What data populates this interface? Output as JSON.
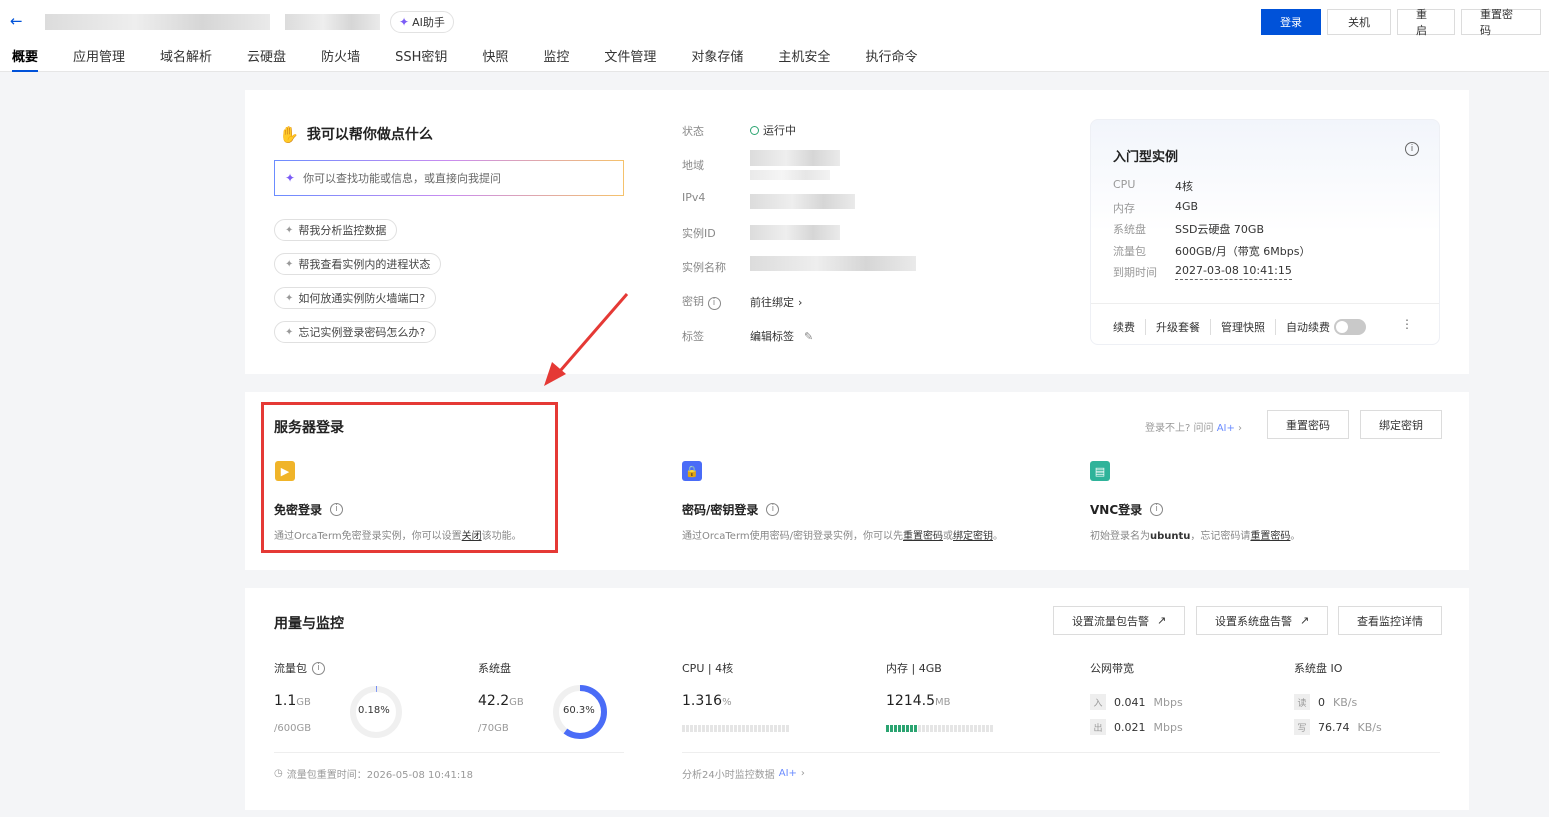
{
  "header": {
    "ai_label": "AI助手",
    "actions": [
      "登录",
      "关机",
      "重启",
      "重置密码"
    ]
  },
  "tabs": [
    "概要",
    "应用管理",
    "域名解析",
    "云硬盘",
    "防火墙",
    "SSH密钥",
    "快照",
    "监控",
    "文件管理",
    "对象存储",
    "主机安全",
    "执行命令"
  ],
  "helper": {
    "title": "我可以帮你做点什么",
    "placeholder": "你可以查找功能或信息，或直接向我提问",
    "chips": [
      "帮我分析监控数据",
      "帮我查看实例内的进程状态",
      "如何放通实例防火墙端口?",
      "忘记实例登录密码怎么办?"
    ]
  },
  "info": {
    "labels": [
      "状态",
      "地域",
      "IPv4",
      "实例ID",
      "实例名称",
      "密钥",
      "标签"
    ],
    "status": "运行中",
    "key_action": "前往绑定",
    "tag_action": "编辑标签"
  },
  "spec": {
    "title": "入门型实例",
    "rows": [
      {
        "k": "CPU",
        "v": "4核"
      },
      {
        "k": "内存",
        "v": "4GB"
      },
      {
        "k": "系统盘",
        "v": "SSD云硬盘 70GB"
      },
      {
        "k": "流量包",
        "v": "600GB/月（带宽 6Mbps）"
      },
      {
        "k": "到期时间",
        "v": "2027-03-08 10:41:15"
      }
    ],
    "actions": [
      "续费",
      "升级套餐",
      "管理快照"
    ],
    "auto_renew": "自动续费"
  },
  "login": {
    "title": "服务器登录",
    "help": "登录不上? 问问",
    "help_ai": "AI+",
    "reset_pwd": "重置密码",
    "bind_key": "绑定密钥",
    "methods": [
      {
        "name": "免密登录",
        "desc_a": "通过OrcaTerm免密登录实例，你可以设置",
        "link1": "关闭",
        "desc_b": "该功能。"
      },
      {
        "name": "密码/密钥登录",
        "desc_a": "通过OrcaTerm使用密码/密钥登录实例，你可以先",
        "link1": "重置密码",
        "mid": "或",
        "link2": "绑定密钥",
        "desc_b": "。"
      },
      {
        "name": "VNC登录",
        "desc_a": "初始登录名为",
        "bold": "ubuntu",
        "desc_m": "，忘记密码请",
        "link1": "重置密码",
        "desc_b": "。"
      }
    ]
  },
  "usage": {
    "title": "用量与监控",
    "buttons": [
      "设置流量包告警",
      "设置系统盘告警",
      "查看监控详情"
    ],
    "traffic": {
      "label": "流量包",
      "value": "1.1",
      "unit": "GB",
      "total": "/600GB",
      "percent_label": "0.18%",
      "percent": 0.18
    },
    "disk": {
      "label": "系统盘",
      "value": "42.2",
      "unit": "GB",
      "total": "/70GB",
      "percent_label": "60.3%",
      "percent": 60.3
    },
    "cpu": {
      "label": "CPU | 4核",
      "value": "1.316",
      "unit": "%",
      "fill": 0.0
    },
    "mem": {
      "label": "内存 | 4GB",
      "value": "1214.5",
      "unit": "MB",
      "fill": 0.3
    },
    "bandwidth": {
      "label": "公网带宽",
      "in_tag": "入",
      "in_val": "0.041",
      "in_unit": "Mbps",
      "out_tag": "出",
      "out_val": "0.021",
      "out_unit": "Mbps"
    },
    "diskio": {
      "label": "系统盘 IO",
      "r_tag": "读",
      "r_val": "0",
      "r_unit": "KB/s",
      "w_tag": "写",
      "w_val": "76.74",
      "w_unit": "KB/s"
    },
    "reset_time": "流量包重置时间：2026-05-08 10:41:18",
    "analyze": "分析24小时监控数据",
    "analyze_ai": "AI+"
  }
}
